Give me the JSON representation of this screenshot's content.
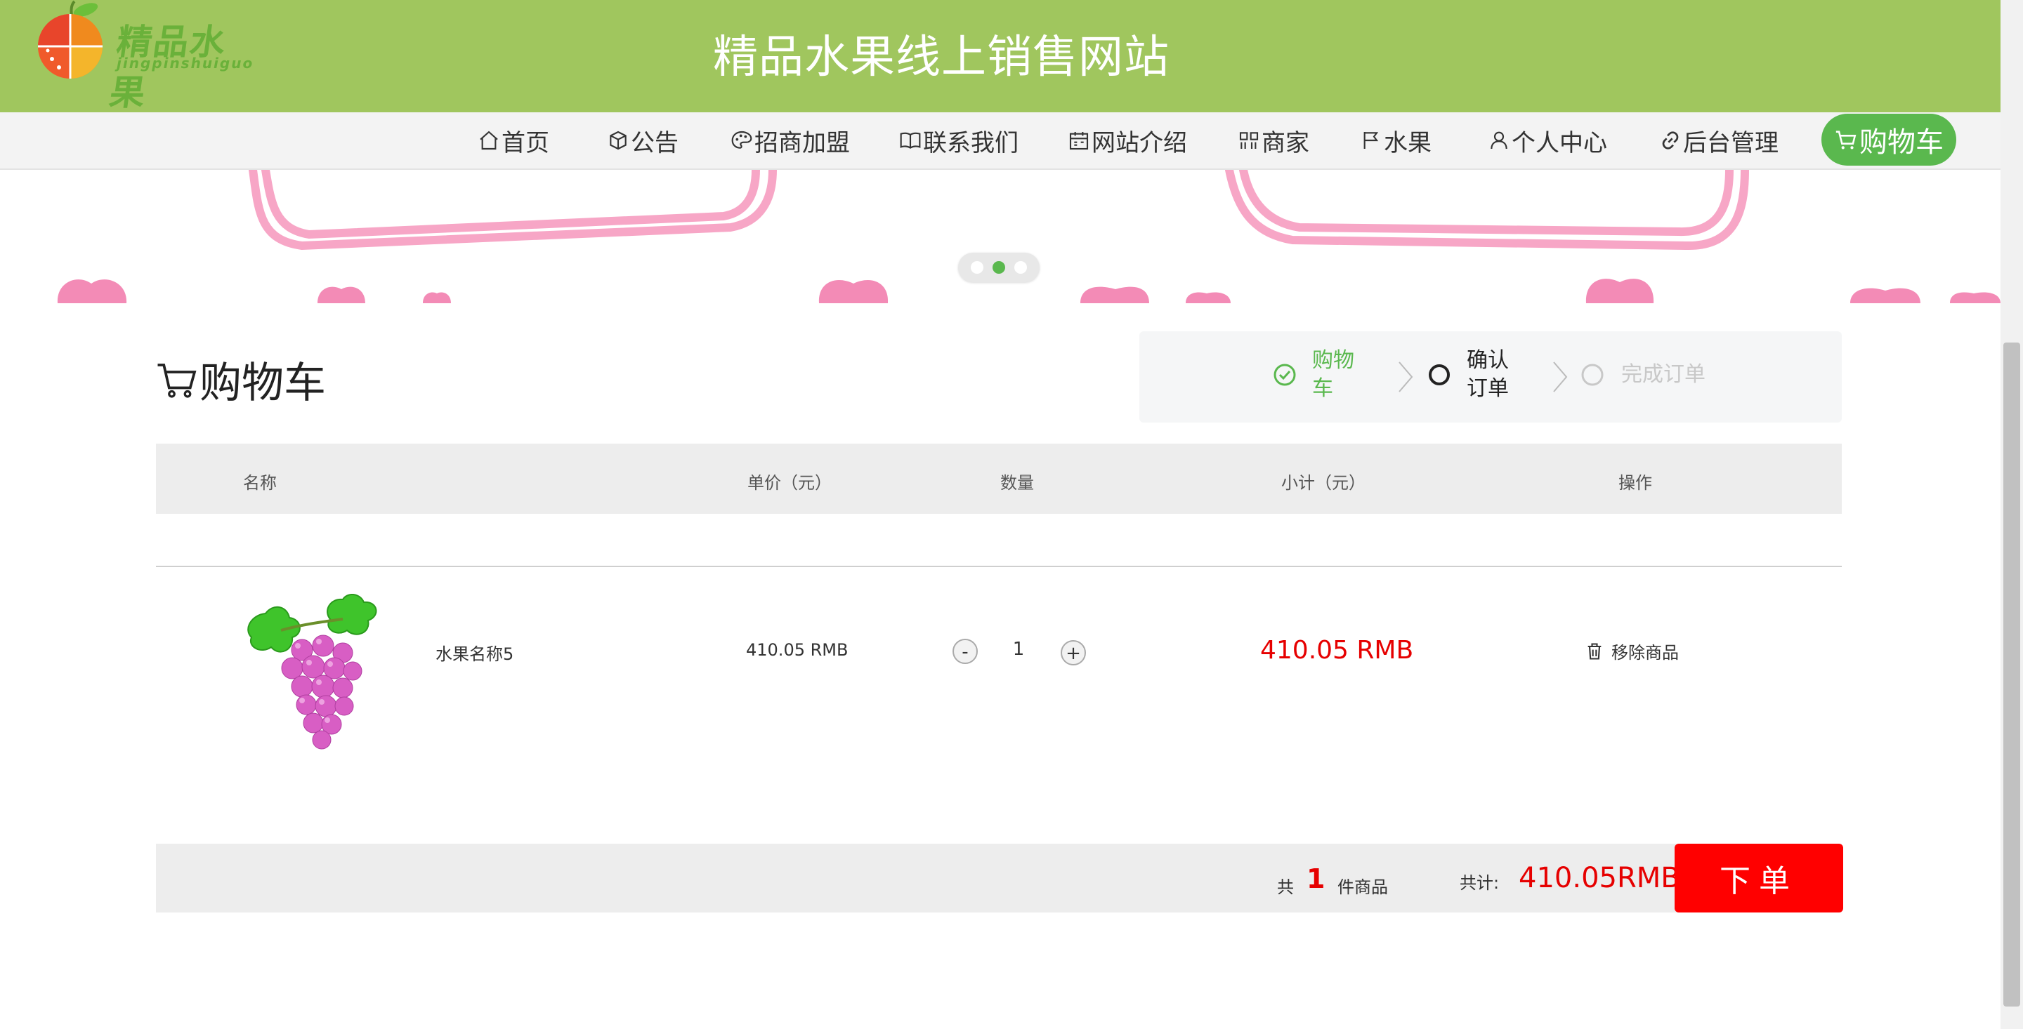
{
  "header": {
    "logo_text": "精品水果",
    "logo_subtext": "jingpinshuiguo",
    "site_title": "精品水果线上销售网站"
  },
  "nav": {
    "items": [
      {
        "label": "首页",
        "icon": "home-icon"
      },
      {
        "label": "公告",
        "icon": "box-icon"
      },
      {
        "label": "招商加盟",
        "icon": "palette-icon"
      },
      {
        "label": "联系我们",
        "icon": "book-icon"
      },
      {
        "label": "网站介绍",
        "icon": "calendar-icon"
      },
      {
        "label": "商家",
        "icon": "grid-icon"
      },
      {
        "label": "水果",
        "icon": "flag-icon"
      },
      {
        "label": "个人中心",
        "icon": "user-icon"
      },
      {
        "label": "后台管理",
        "icon": "link-icon"
      }
    ],
    "cart_label": "购物车",
    "active_color": "#5ab84e"
  },
  "banner": {
    "slide_count": 3,
    "active_slide": 2
  },
  "cart": {
    "title": "购物车",
    "steps": [
      {
        "label": "购物车",
        "state": "done"
      },
      {
        "label": "确认订单",
        "state": "current"
      },
      {
        "label": "完成订单",
        "state": "pending"
      }
    ],
    "columns": [
      "名称",
      "单价（元）",
      "数量",
      "小计（元）",
      "操作"
    ],
    "items": [
      {
        "image": "grape-image",
        "name": "水果名称5",
        "unit_price": "410.05 RMB",
        "quantity": "1",
        "decrement": "-",
        "increment": "+",
        "subtotal": "410.05 RMB",
        "action": "移除商品"
      }
    ],
    "summary": {
      "prefix": "共",
      "count": "1",
      "suffix": "件商品",
      "total_label": "共计:",
      "total": "410.05RMB",
      "order_button": "下单"
    }
  },
  "colors": {
    "header_bg": "#a0c65e",
    "accent_green": "#5ab84e",
    "price_red": "#e60000",
    "order_red": "#ff0000"
  }
}
